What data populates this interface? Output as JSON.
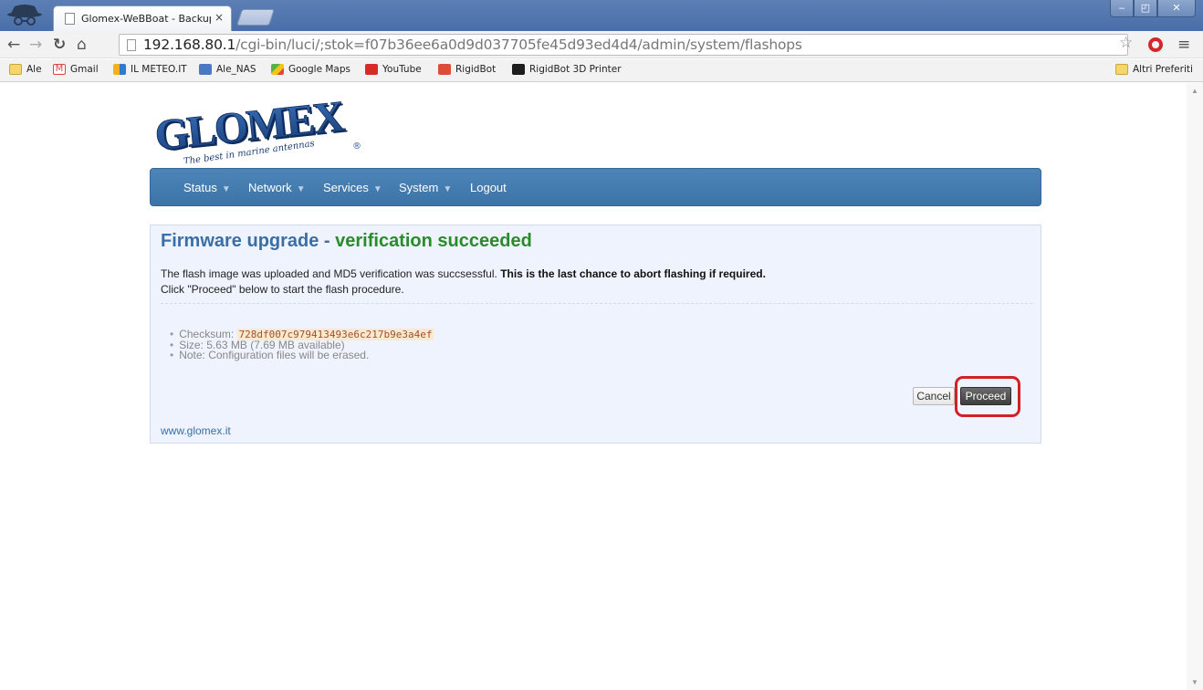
{
  "browser": {
    "tab_title": "Glomex-WeBBoat - Backup",
    "tab_close": "×",
    "url_host": "192.168.80.1",
    "url_path": "/cgi-bin/luci/;stok=f07b36ee6a0d9d037705fe45d93ed4d4/admin/system/flashops",
    "window_controls": [
      "‒",
      "◰",
      "✕"
    ],
    "bookmarks": [
      {
        "label": "Ale",
        "icon": "folder-icon"
      },
      {
        "label": "Gmail",
        "icon": "gmail-icon"
      },
      {
        "label": "IL METEO.IT",
        "icon": "ilmeteo-icon"
      },
      {
        "label": "Ale_NAS",
        "icon": "dsm-icon"
      },
      {
        "label": "Google Maps",
        "icon": "google-maps-icon"
      },
      {
        "label": "YouTube",
        "icon": "youtube-icon"
      },
      {
        "label": "RigidBot",
        "icon": "google-plus-icon"
      },
      {
        "label": "RigidBot 3D Printer",
        "icon": "kickstarter-icon"
      }
    ],
    "other_bookmarks": "Altri Preferiti"
  },
  "navbar": {
    "items": [
      {
        "label": "Status",
        "has_dropdown": true
      },
      {
        "label": "Network",
        "has_dropdown": true
      },
      {
        "label": "Services",
        "has_dropdown": true
      },
      {
        "label": "System",
        "has_dropdown": true
      },
      {
        "label": "Logout",
        "has_dropdown": false
      }
    ],
    "caret": "▼"
  },
  "main": {
    "heading_prefix": "Firmware upgrade - ",
    "heading_status": "verification succeeded",
    "description_line1": "The flash image was uploaded and MD5 verification was succsessful. ",
    "description_bold": "This is the last chance to abort flashing if required.",
    "description_line2": "Click \"Proceed\" below to start the flash procedure.",
    "checksum_label": "Checksum: ",
    "checksum_value": "728df007c979413493e6c217b9e3a4ef",
    "size_text": "Size: 5.63 MB (7.69 MB available)",
    "note_text": "Note: Configuration files will be erased.",
    "cancel_label": "Cancel",
    "proceed_label": "Proceed",
    "footer_link": "www.glomex.it"
  },
  "logo": {
    "brand": "GLOMEX",
    "tagline": "The best in marine antennas",
    "registered": "®"
  },
  "colors": {
    "navbar": "#3c74a8",
    "heading": "#3a6ea5",
    "success": "#2b8a2b",
    "highlight": "#d31f26",
    "panel_bg": "#eef3fd"
  }
}
